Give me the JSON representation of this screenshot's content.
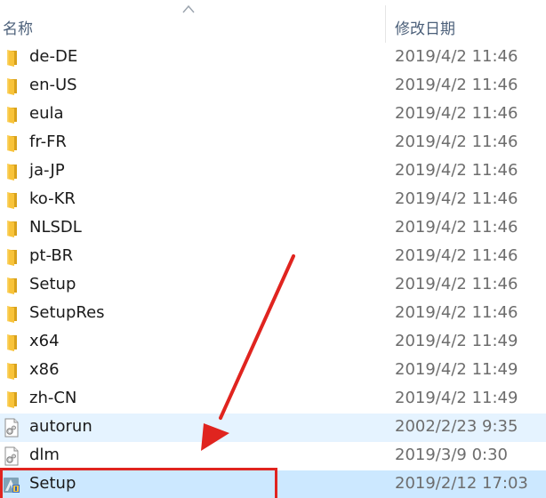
{
  "header": {
    "name_label": "名称",
    "date_label": "修改日期"
  },
  "files": [
    {
      "name": "de-DE",
      "date": "2019/4/2 11:46",
      "type": "folder"
    },
    {
      "name": "en-US",
      "date": "2019/4/2 11:46",
      "type": "folder"
    },
    {
      "name": "eula",
      "date": "2019/4/2 11:46",
      "type": "folder"
    },
    {
      "name": "fr-FR",
      "date": "2019/4/2 11:46",
      "type": "folder"
    },
    {
      "name": "ja-JP",
      "date": "2019/4/2 11:46",
      "type": "folder"
    },
    {
      "name": "ko-KR",
      "date": "2019/4/2 11:46",
      "type": "folder"
    },
    {
      "name": "NLSDL",
      "date": "2019/4/2 11:46",
      "type": "folder"
    },
    {
      "name": "pt-BR",
      "date": "2019/4/2 11:46",
      "type": "folder"
    },
    {
      "name": "Setup",
      "date": "2019/4/2 11:46",
      "type": "folder"
    },
    {
      "name": "SetupRes",
      "date": "2019/4/2 11:46",
      "type": "folder"
    },
    {
      "name": "x64",
      "date": "2019/4/2 11:49",
      "type": "folder"
    },
    {
      "name": "x86",
      "date": "2019/4/2 11:49",
      "type": "folder"
    },
    {
      "name": "zh-CN",
      "date": "2019/4/2 11:49",
      "type": "folder"
    },
    {
      "name": "autorun",
      "date": "2002/2/23 9:35",
      "type": "settings-file"
    },
    {
      "name": "dlm",
      "date": "2019/3/9 0:30",
      "type": "settings-file"
    },
    {
      "name": "Setup",
      "date": "2019/2/12 17:03",
      "type": "setup-exe"
    }
  ],
  "hovered_row": 13,
  "selected_row": 15,
  "colors": {
    "selection": "#cce8ff",
    "hover": "#e5f3ff",
    "annotation_red": "#e0241f",
    "folder_yellow": "#f8c33a",
    "folder_dark": "#d9a21b"
  }
}
